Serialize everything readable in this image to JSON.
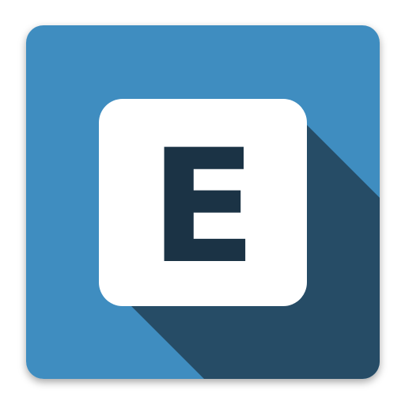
{
  "icon": {
    "letter": "E",
    "name": "app-icon-letter-e",
    "colors": {
      "background": "#3f8dc0",
      "long_shadow": "#24465e",
      "tile": "#ffffff",
      "letter": "#1b3345"
    }
  }
}
